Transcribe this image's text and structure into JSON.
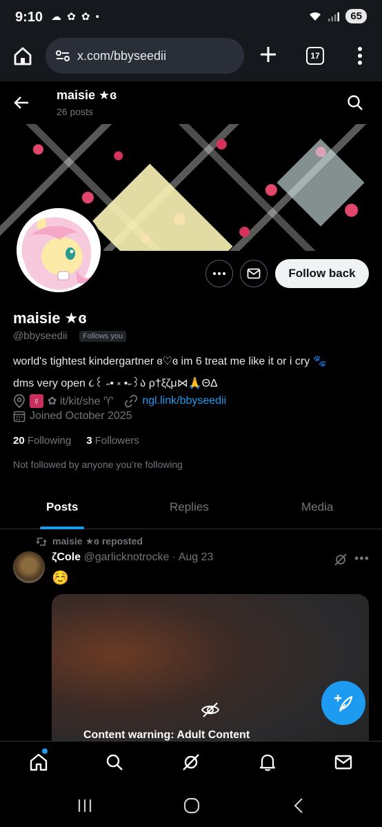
{
  "status_bar": {
    "time": "9:10",
    "notif_icons": "☁ ✿ ✿ •",
    "battery": "65"
  },
  "browser": {
    "url": "x.com/bbyseedii",
    "tab_count": "17"
  },
  "header": {
    "name": "maisie ★ɞ",
    "posts": "26 posts"
  },
  "profile": {
    "name": "maisie ★ɞ",
    "handle": "@bbyseedii",
    "follows_you": "Follows you",
    "bio_line1": "world's tightest kindergartner ɞ♡ɞ im 6 treat me like it or i cry ",
    "bio_paws": "🐾",
    "bio_line2": "dms very open  ૮꒰ ˶• ༝ •˶꒱ა  ρ†ξζμ⋈🙏ΘΔ",
    "pronouns": "✿ it/kit/she ♈︎",
    "venus_symbol": "♀",
    "link": "ngl.link/bbyseedii",
    "joined": "Joined October 2025",
    "following_count": "20",
    "following_label": "Following",
    "followers_count": "3",
    "followers_label": "Followers",
    "not_followed": "Not followed by anyone you’re following",
    "follow_back_label": "Follow back"
  },
  "tabs": [
    {
      "label": "Posts",
      "active": true
    },
    {
      "label": "Replies",
      "active": false
    },
    {
      "label": "Media",
      "active": false
    }
  ],
  "post": {
    "repost_text": "maisie ★ɞ reposted",
    "author_name": "ζCole",
    "author_handle": "@garlicknotrocke",
    "date": "· Aug 23",
    "emoji": "☺️",
    "content_warning": "Content warning: Adult Content"
  },
  "colors": {
    "accent": "#1d9bf0",
    "background": "#000000",
    "muted_text": "#71767b"
  },
  "icons": [
    "home-icon",
    "search-icon",
    "grok-icon",
    "notifications-icon",
    "messages-icon",
    "compose-icon",
    "back-arrow-icon"
  ]
}
